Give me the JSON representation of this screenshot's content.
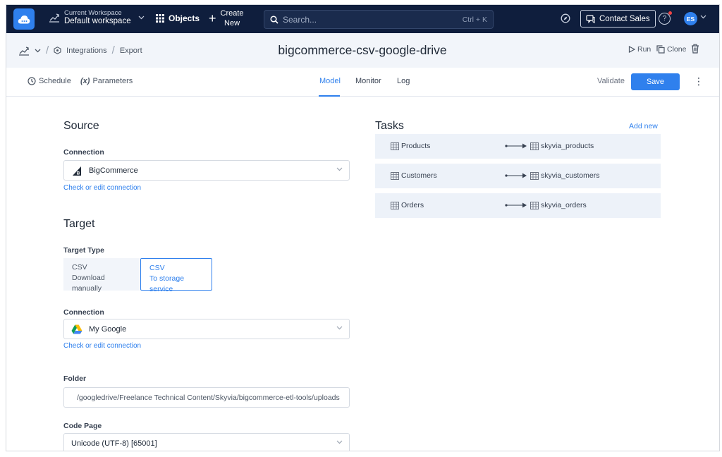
{
  "topbar": {
    "workspace_label": "Current Workspace",
    "workspace_value": "Default workspace",
    "objects_label": "Objects",
    "create_label_1": "Create",
    "create_label_2": "New",
    "search_placeholder": "Search...",
    "search_shortcut": "Ctrl + K",
    "contact_label": "Contact Sales",
    "help_label": "?",
    "avatar_initials": "ES"
  },
  "breadcrumb": {
    "items": [
      "Integrations",
      "Export"
    ],
    "title": "bigcommerce-csv-google-drive",
    "run_label": "Run",
    "clone_label": "Clone"
  },
  "tabs": {
    "schedule_label": "Schedule",
    "parameters_prefix": "(x)",
    "parameters_label": "Parameters",
    "items": [
      "Model",
      "Monitor",
      "Log"
    ],
    "active": "Model",
    "validate_label": "Validate",
    "save_label": "Save"
  },
  "source": {
    "title": "Source",
    "connection_label": "Connection",
    "connection_value": "BigCommerce",
    "link": "Check or edit connection"
  },
  "target": {
    "title": "Target",
    "type_label": "Target Type",
    "types": [
      {
        "title": "CSV",
        "subtitle": "Download manually",
        "selected": false
      },
      {
        "title": "CSV",
        "subtitle": "To storage service",
        "selected": true
      }
    ],
    "connection_label": "Connection",
    "connection_value": "My Google",
    "link": "Check or edit connection",
    "folder_label": "Folder",
    "folder_value": "/googledrive/Freelance Technical Content/Skyvia/bigcommerce-etl-tools/uploads",
    "codepage_label": "Code Page",
    "codepage_value": "Unicode (UTF-8) [65001]"
  },
  "tasks": {
    "title": "Tasks",
    "add_label": "Add new",
    "items": [
      {
        "source": "Products",
        "target": "skyvia_products"
      },
      {
        "source": "Customers",
        "target": "skyvia_customers"
      },
      {
        "source": "Orders",
        "target": "skyvia_orders"
      }
    ]
  },
  "colors": {
    "nav_bg": "#0f1e3d",
    "accent": "#2f80ed",
    "task_bg": "#edf2f9"
  }
}
